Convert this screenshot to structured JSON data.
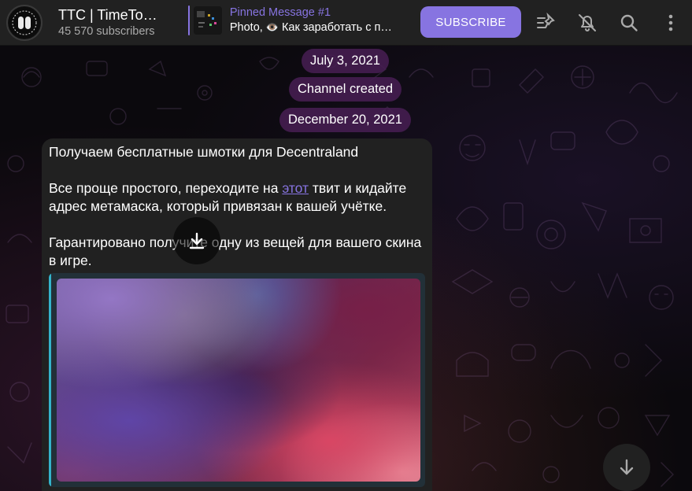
{
  "header": {
    "channel_title": "TTC | TimeTo…",
    "subscribers": "45 570 subscribers",
    "pinned": {
      "title": "Pinned Message #1",
      "prefix": "Photo,",
      "emoji": "👁️",
      "text": "Как заработать с п…"
    },
    "subscribe_label": "SUBSCRIBE",
    "icons": [
      "pinned-list-icon",
      "mute-bell-icon",
      "search-icon",
      "more-vertical-icon"
    ]
  },
  "service": {
    "date_1": "July 3, 2021",
    "channel_created": "Channel created",
    "date_2": "December 20, 2021"
  },
  "message": {
    "line_1": "Получаем бесплатные шмотки для Decentraland",
    "para_2_before": "Все проще простого, переходите на ",
    "para_2_link": "этот",
    "para_2_after": " твит и кидайте адрес метамаска, который привязан к вашей учётке.",
    "para_3": "Гарантировано получите одну из вещей для вашего скина в игре."
  },
  "colors": {
    "accent": "#8774e1",
    "header_bg": "#212121",
    "bubble_bg": "#212121",
    "pill_bg": "#481e54",
    "preview_bar": "#34b4cb"
  }
}
